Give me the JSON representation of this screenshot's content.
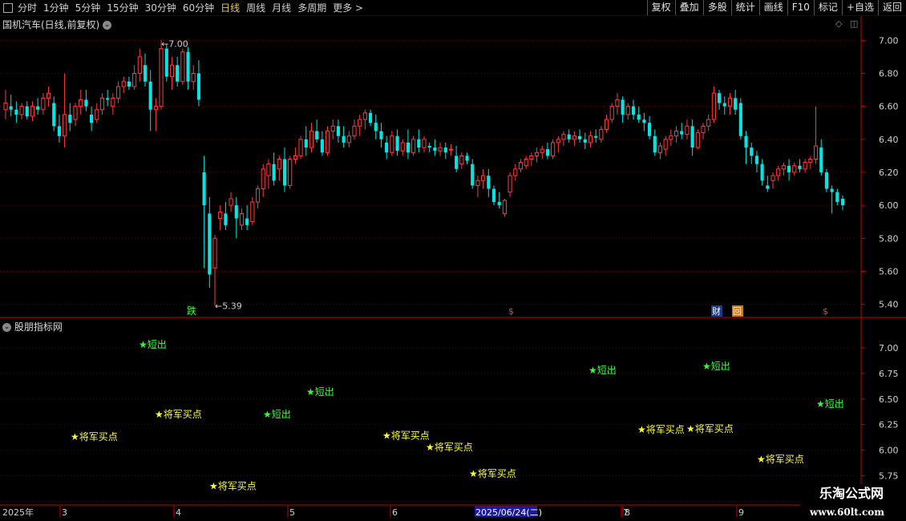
{
  "toolbar": {
    "periods": [
      "分时",
      "1分钟",
      "5分钟",
      "15分钟",
      "30分钟",
      "60分钟",
      "日线",
      "周线",
      "月线",
      "多周期",
      "更多 >"
    ],
    "active_period": "日线",
    "right_buttons": [
      "复权",
      "叠加",
      "多股",
      "统计",
      "画线",
      "F10",
      "标记",
      "+自选",
      "返回"
    ]
  },
  "main_panel": {
    "title": "国机汽车(日线,前复权)"
  },
  "sub_panel": {
    "title": "股朋指标网"
  },
  "markers": {
    "fall": "跌",
    "fin": "财",
    "hui": "回",
    "dollar": "$"
  },
  "watermark": {
    "line1": "乐淘公式网",
    "line2": "www.60lt.com"
  },
  "timeline": {
    "labels": [
      "2025年",
      "3",
      "4",
      "5",
      "6",
      "2025/06/24(二)",
      "7",
      "8",
      "9"
    ]
  },
  "colors": {
    "up": "#ff3c3c",
    "down": "#00e5e5",
    "buy": "#ffff33",
    "sell": "#33ff33",
    "axis": "#cc0000"
  },
  "chart_data": {
    "type": "candlestick",
    "y_axis_ticks": [
      "7.00",
      "6.80",
      "6.60",
      "6.40",
      "6.20",
      "6.00",
      "5.80",
      "5.60",
      "5.40"
    ],
    "ylim": [
      5.33,
      7.06
    ],
    "high_label": "7.00",
    "low_label": "5.39",
    "candles": [
      [
        6.58,
        6.7,
        6.52,
        6.62
      ],
      [
        6.6,
        6.67,
        6.54,
        6.58
      ],
      [
        6.58,
        6.63,
        6.5,
        6.55
      ],
      [
        6.55,
        6.62,
        6.52,
        6.6
      ],
      [
        6.6,
        6.63,
        6.52,
        6.54
      ],
      [
        6.54,
        6.63,
        6.51,
        6.6
      ],
      [
        6.6,
        6.65,
        6.55,
        6.58
      ],
      [
        6.58,
        6.68,
        6.55,
        6.65
      ],
      [
        6.65,
        6.72,
        6.6,
        6.68
      ],
      [
        6.62,
        6.66,
        6.45,
        6.48
      ],
      [
        6.48,
        6.55,
        6.38,
        6.42
      ],
      [
        6.42,
        6.8,
        6.35,
        6.55
      ],
      [
        6.55,
        6.62,
        6.45,
        6.5
      ],
      [
        6.52,
        6.62,
        6.48,
        6.6
      ],
      [
        6.6,
        6.7,
        6.55,
        6.64
      ],
      [
        6.64,
        6.7,
        6.57,
        6.6
      ],
      [
        6.55,
        6.6,
        6.45,
        6.5
      ],
      [
        6.52,
        6.62,
        6.5,
        6.58
      ],
      [
        6.58,
        6.68,
        6.55,
        6.65
      ],
      [
        6.65,
        6.7,
        6.6,
        6.64
      ],
      [
        6.6,
        6.68,
        6.55,
        6.65
      ],
      [
        6.65,
        6.75,
        6.62,
        6.72
      ],
      [
        6.72,
        6.78,
        6.68,
        6.75
      ],
      [
        6.75,
        6.78,
        6.7,
        6.72
      ],
      [
        6.72,
        6.85,
        6.7,
        6.8
      ],
      [
        6.8,
        6.95,
        6.75,
        6.9
      ],
      [
        6.85,
        6.92,
        6.72,
        6.75
      ],
      [
        6.75,
        6.82,
        6.45,
        6.58
      ],
      [
        6.58,
        6.65,
        6.45,
        6.6
      ],
      [
        6.6,
        7.0,
        6.58,
        6.95
      ],
      [
        6.95,
        6.98,
        6.75,
        6.78
      ],
      [
        6.78,
        6.9,
        6.7,
        6.85
      ],
      [
        6.85,
        6.9,
        6.72,
        6.75
      ],
      [
        6.75,
        6.95,
        6.73,
        6.93
      ],
      [
        6.93,
        6.96,
        6.7,
        6.75
      ],
      [
        6.75,
        6.85,
        6.7,
        6.8
      ],
      [
        6.8,
        6.88,
        6.6,
        6.64
      ],
      [
        6.2,
        6.3,
        5.62,
        6.0
      ],
      [
        5.95,
        6.05,
        5.5,
        5.58
      ],
      [
        5.62,
        5.82,
        5.39,
        5.8
      ],
      [
        5.92,
        6.0,
        5.85,
        5.96
      ],
      [
        5.95,
        6.02,
        5.85,
        5.88
      ],
      [
        6.0,
        6.08,
        5.96,
        6.04
      ],
      [
        6.0,
        6.05,
        5.8,
        5.92
      ],
      [
        5.88,
        5.98,
        5.85,
        5.95
      ],
      [
        5.92,
        6.0,
        5.85,
        5.88
      ],
      [
        5.9,
        6.05,
        5.88,
        6.02
      ],
      [
        6.02,
        6.12,
        5.98,
        6.1
      ],
      [
        6.1,
        6.25,
        6.05,
        6.22
      ],
      [
        6.18,
        6.28,
        6.1,
        6.25
      ],
      [
        6.25,
        6.32,
        6.12,
        6.15
      ],
      [
        6.22,
        6.3,
        6.15,
        6.28
      ],
      [
        6.28,
        6.35,
        6.08,
        6.12
      ],
      [
        6.12,
        6.3,
        6.1,
        6.28
      ],
      [
        6.28,
        6.35,
        6.25,
        6.3
      ],
      [
        6.3,
        6.42,
        6.28,
        6.4
      ],
      [
        6.4,
        6.48,
        6.3,
        6.35
      ],
      [
        6.35,
        6.5,
        6.32,
        6.45
      ],
      [
        6.45,
        6.52,
        6.38,
        6.4
      ],
      [
        6.4,
        6.45,
        6.3,
        6.32
      ],
      [
        6.32,
        6.48,
        6.3,
        6.45
      ],
      [
        6.45,
        6.52,
        6.4,
        6.48
      ],
      [
        6.48,
        6.52,
        6.38,
        6.42
      ],
      [
        6.42,
        6.48,
        6.35,
        6.38
      ],
      [
        6.38,
        6.45,
        6.35,
        6.42
      ],
      [
        6.42,
        6.52,
        6.4,
        6.48
      ],
      [
        6.48,
        6.55,
        6.42,
        6.52
      ],
      [
        6.52,
        6.58,
        6.46,
        6.56
      ],
      [
        6.56,
        6.58,
        6.48,
        6.5
      ],
      [
        6.5,
        6.55,
        6.4,
        6.45
      ],
      [
        6.45,
        6.5,
        6.35,
        6.4
      ],
      [
        6.38,
        6.42,
        6.28,
        6.32
      ],
      [
        6.32,
        6.45,
        6.3,
        6.42
      ],
      [
        6.42,
        6.46,
        6.3,
        6.33
      ],
      [
        6.33,
        6.4,
        6.3,
        6.38
      ],
      [
        6.38,
        6.46,
        6.28,
        6.32
      ],
      [
        6.32,
        6.42,
        6.3,
        6.4
      ],
      [
        6.4,
        6.46,
        6.32,
        6.35
      ],
      [
        6.35,
        6.42,
        6.32,
        6.4
      ],
      [
        6.36,
        6.38,
        6.32,
        6.35
      ],
      [
        6.35,
        6.4,
        6.3,
        6.33
      ],
      [
        6.33,
        6.38,
        6.3,
        6.35
      ],
      [
        6.35,
        6.38,
        6.28,
        6.32
      ],
      [
        6.34,
        6.37,
        6.3,
        6.34
      ],
      [
        6.3,
        6.36,
        6.2,
        6.22
      ],
      [
        6.25,
        6.32,
        6.22,
        6.3
      ],
      [
        6.3,
        6.32,
        6.25,
        6.27
      ],
      [
        6.25,
        6.28,
        6.1,
        6.12
      ],
      [
        6.12,
        6.18,
        6.05,
        6.15
      ],
      [
        6.15,
        6.22,
        6.1,
        6.18
      ],
      [
        6.18,
        6.22,
        6.05,
        6.1
      ],
      [
        6.1,
        6.12,
        6.0,
        6.02
      ],
      [
        6.02,
        6.08,
        5.98,
        6.0
      ],
      [
        5.95,
        6.04,
        5.93,
        6.03
      ],
      [
        6.08,
        6.2,
        6.05,
        6.18
      ],
      [
        6.18,
        6.25,
        6.15,
        6.22
      ],
      [
        6.22,
        6.28,
        6.2,
        6.26
      ],
      [
        6.24,
        6.3,
        6.22,
        6.28
      ],
      [
        6.28,
        6.32,
        6.24,
        6.3
      ],
      [
        6.3,
        6.35,
        6.26,
        6.32
      ],
      [
        6.32,
        6.36,
        6.28,
        6.34
      ],
      [
        6.34,
        6.38,
        6.28,
        6.3
      ],
      [
        6.3,
        6.4,
        6.28,
        6.38
      ],
      [
        6.38,
        6.42,
        6.32,
        6.4
      ],
      [
        6.4,
        6.45,
        6.36,
        6.43
      ],
      [
        6.43,
        6.46,
        6.38,
        6.4
      ],
      [
        6.4,
        6.45,
        6.36,
        6.42
      ],
      [
        6.42,
        6.46,
        6.38,
        6.4
      ],
      [
        6.4,
        6.44,
        6.34,
        6.38
      ],
      [
        6.38,
        6.45,
        6.35,
        6.42
      ],
      [
        6.42,
        6.46,
        6.38,
        6.41
      ],
      [
        6.4,
        6.48,
        6.38,
        6.46
      ],
      [
        6.46,
        6.55,
        6.44,
        6.52
      ],
      [
        6.52,
        6.62,
        6.5,
        6.6
      ],
      [
        6.6,
        6.68,
        6.55,
        6.64
      ],
      [
        6.64,
        6.66,
        6.5,
        6.55
      ],
      [
        6.55,
        6.62,
        6.52,
        6.6
      ],
      [
        6.6,
        6.64,
        6.52,
        6.55
      ],
      [
        6.55,
        6.6,
        6.5,
        6.52
      ],
      [
        6.52,
        6.56,
        6.45,
        6.5
      ],
      [
        6.5,
        6.54,
        6.4,
        6.42
      ],
      [
        6.42,
        6.46,
        6.3,
        6.32
      ],
      [
        6.32,
        6.38,
        6.28,
        6.36
      ],
      [
        6.34,
        6.42,
        6.3,
        6.4
      ],
      [
        6.4,
        6.46,
        6.36,
        6.42
      ],
      [
        6.42,
        6.48,
        6.38,
        6.45
      ],
      [
        6.45,
        6.5,
        6.4,
        6.43
      ],
      [
        6.43,
        6.52,
        6.4,
        6.48
      ],
      [
        6.48,
        6.52,
        6.3,
        6.35
      ],
      [
        6.35,
        6.46,
        6.34,
        6.44
      ],
      [
        6.44,
        6.5,
        6.4,
        6.48
      ],
      [
        6.48,
        6.55,
        6.45,
        6.52
      ],
      [
        6.52,
        6.72,
        6.5,
        6.68
      ],
      [
        6.68,
        6.7,
        6.58,
        6.62
      ],
      [
        6.62,
        6.66,
        6.55,
        6.6
      ],
      [
        6.6,
        6.68,
        6.55,
        6.65
      ],
      [
        6.65,
        6.7,
        6.55,
        6.58
      ],
      [
        6.62,
        6.65,
        6.4,
        6.42
      ],
      [
        6.42,
        6.45,
        6.25,
        6.35
      ],
      [
        6.35,
        6.38,
        6.25,
        6.3
      ],
      [
        6.3,
        6.33,
        6.2,
        6.25
      ],
      [
        6.25,
        6.28,
        6.12,
        6.15
      ],
      [
        6.12,
        6.18,
        6.08,
        6.1
      ],
      [
        6.15,
        6.2,
        6.1,
        6.18
      ],
      [
        6.18,
        6.24,
        6.15,
        6.22
      ],
      [
        6.22,
        6.26,
        6.18,
        6.24
      ],
      [
        6.24,
        6.28,
        6.15,
        6.2
      ],
      [
        6.2,
        6.26,
        6.18,
        6.24
      ],
      [
        6.24,
        6.28,
        6.2,
        6.22
      ],
      [
        6.22,
        6.28,
        6.2,
        6.26
      ],
      [
        6.26,
        6.3,
        6.22,
        6.28
      ],
      [
        6.28,
        6.6,
        6.25,
        6.36
      ],
      [
        6.35,
        6.4,
        6.18,
        6.2
      ],
      [
        6.2,
        6.22,
        6.08,
        6.1
      ],
      [
        6.1,
        6.12,
        5.95,
        6.08
      ],
      [
        6.08,
        6.1,
        6.0,
        6.02
      ],
      [
        6.04,
        6.06,
        5.97,
        6.0
      ]
    ],
    "signals": [
      {
        "label": "将军买点",
        "type": "buy",
        "value": 6.13
      },
      {
        "label": "短出",
        "type": "sell",
        "value": 7.03
      },
      {
        "label": "将军买点",
        "type": "buy",
        "value": 6.35
      },
      {
        "label": "将军买点",
        "type": "buy",
        "value": 5.65
      },
      {
        "label": "短出",
        "type": "sell",
        "value": 6.35
      },
      {
        "label": "短出",
        "type": "sell",
        "value": 6.57
      },
      {
        "label": "将军买点",
        "type": "buy",
        "value": 6.14
      },
      {
        "label": "将军买点",
        "type": "buy",
        "value": 6.03
      },
      {
        "label": "将军买点",
        "type": "buy",
        "value": 5.77
      },
      {
        "label": "短出",
        "type": "sell",
        "value": 6.78
      },
      {
        "label": "将军买点",
        "type": "buy",
        "value": 6.2
      },
      {
        "label": "将军买点",
        "type": "buy",
        "value": 6.21
      },
      {
        "label": "短出",
        "type": "sell",
        "value": 6.82
      },
      {
        "label": "将军买点",
        "type": "buy",
        "value": 5.91
      },
      {
        "label": "短出",
        "type": "sell",
        "value": 6.45
      }
    ],
    "indicator_ticks": [
      "7.00",
      "6.75",
      "6.50",
      "6.25",
      "6.00",
      "5.75",
      "5.50"
    ],
    "indicator_ylim": [
      5.48,
      7.25
    ]
  }
}
